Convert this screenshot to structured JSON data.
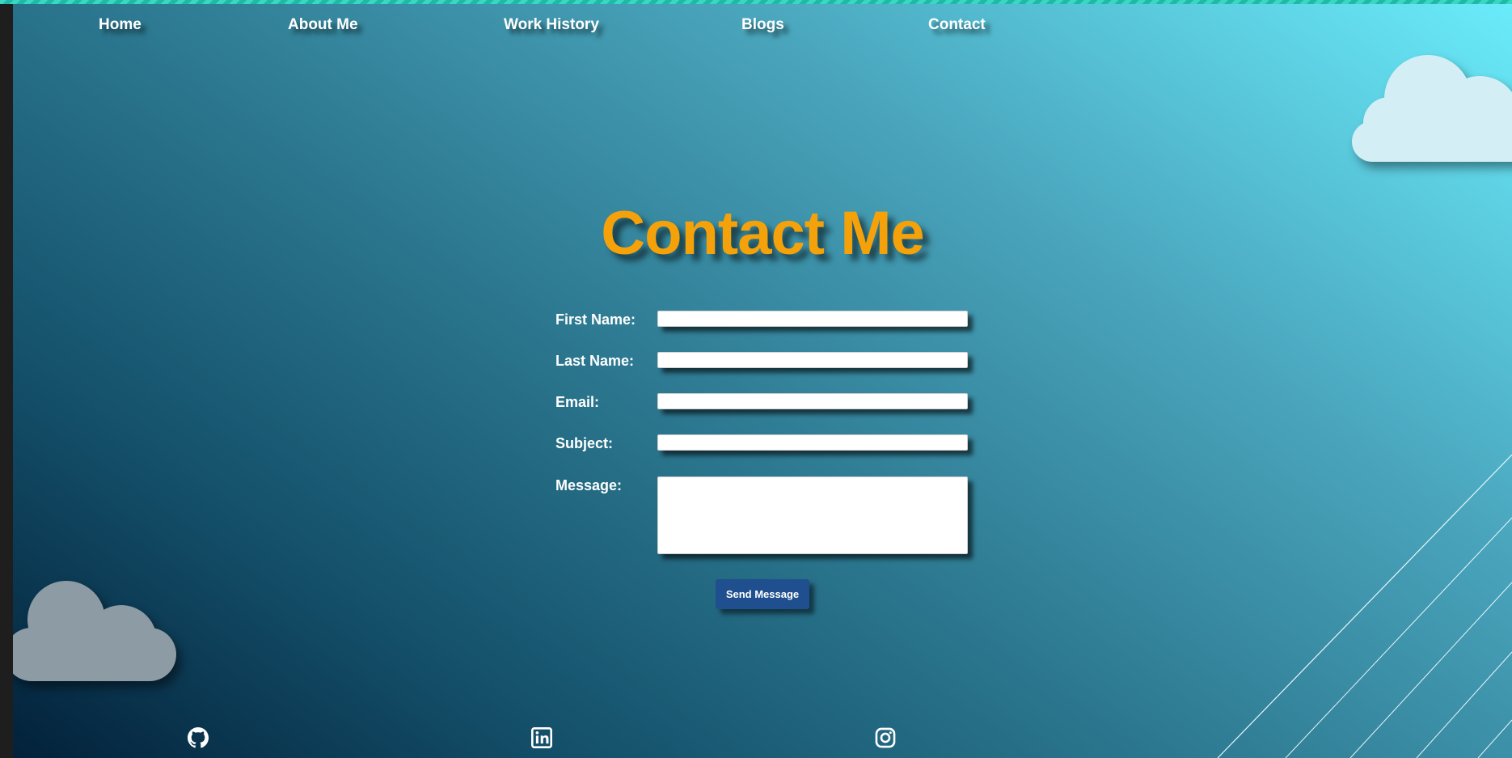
{
  "nav": {
    "items": [
      {
        "label": "Home"
      },
      {
        "label": "About Me"
      },
      {
        "label": "Work History"
      },
      {
        "label": "Blogs"
      },
      {
        "label": "Contact"
      }
    ]
  },
  "main": {
    "title": "Contact Me"
  },
  "form": {
    "fields": [
      {
        "label": "First Name:",
        "value": ""
      },
      {
        "label": "Last Name:",
        "value": ""
      },
      {
        "label": "Email:",
        "value": ""
      },
      {
        "label": "Subject:",
        "value": ""
      },
      {
        "label": "Message:",
        "value": ""
      }
    ],
    "submit_label": "Send Message"
  },
  "footer": {
    "icons": [
      "github-icon",
      "linkedin-icon",
      "instagram-icon"
    ]
  },
  "colors": {
    "title": "#f5a20a",
    "button": "#1f4f8e",
    "top_stripe": "#39d8c0",
    "cloud_light": "#d3eef4",
    "cloud_dark": "#8d9ba4"
  }
}
